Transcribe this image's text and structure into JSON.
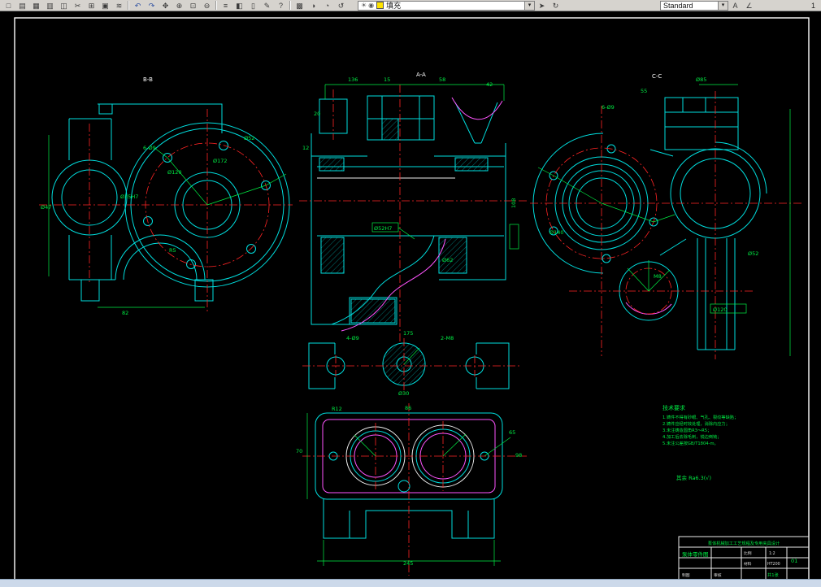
{
  "window": {
    "page_indicator": "1"
  },
  "toolbar": {
    "dropdown_glyph": "▾",
    "groups": [
      [
        {
          "name": "new",
          "glyph": "□"
        },
        {
          "name": "open",
          "glyph": "▤"
        },
        {
          "name": "save",
          "glyph": "▦"
        },
        {
          "name": "print",
          "glyph": "▥"
        },
        {
          "name": "plot-preview",
          "glyph": "◫"
        },
        {
          "name": "cut",
          "glyph": "✂"
        },
        {
          "name": "copy",
          "glyph": "⊞"
        },
        {
          "name": "paste",
          "glyph": "▣"
        },
        {
          "name": "match-properties",
          "glyph": "≋"
        }
      ],
      [
        {
          "name": "undo",
          "glyph": "↶",
          "color": "#2b4ea0"
        },
        {
          "name": "redo",
          "glyph": "↷",
          "color": "#2b4ea0"
        },
        {
          "name": "pan",
          "glyph": "✥"
        },
        {
          "name": "zoom-realtime",
          "glyph": "⊕"
        },
        {
          "name": "zoom-window",
          "glyph": "⊡"
        },
        {
          "name": "zoom-previous",
          "glyph": "⊖"
        }
      ],
      [
        {
          "name": "properties",
          "glyph": "≡"
        },
        {
          "name": "design-center",
          "glyph": "◧"
        },
        {
          "name": "tool-palettes",
          "glyph": "▯"
        },
        {
          "name": "markup",
          "glyph": "✎"
        },
        {
          "name": "help",
          "glyph": "?"
        }
      ],
      [
        {
          "name": "layer-properties",
          "glyph": "▩"
        },
        {
          "name": "layer-states",
          "glyph": "◑"
        },
        {
          "name": "layer-walk",
          "glyph": "◔"
        },
        {
          "name": "layer-previous",
          "glyph": "↺"
        }
      ],
      [
        {
          "name": "make-object-layer-current",
          "glyph": "➤"
        },
        {
          "name": "layer-update",
          "glyph": "↻"
        }
      ],
      [
        {
          "name": "text-style",
          "glyph": "A"
        },
        {
          "name": "dim-style",
          "glyph": "∠"
        }
      ]
    ],
    "layer_combo": {
      "value": "填充",
      "status_icons": [
        {
          "name": "layer-on",
          "glyph": "☀"
        },
        {
          "name": "layer-bulb",
          "glyph": "◉"
        }
      ]
    },
    "style_combo": {
      "value": "Standard"
    }
  },
  "views": {
    "left_label": "B-B",
    "middle_label": "A-A",
    "right_label": "C-C"
  },
  "dims": {
    "d1": "6-Ø9",
    "d2": "Ø120",
    "d3": "Ø35H7",
    "d4": "Ø172",
    "d5": "Ø52",
    "d6": "Ø47",
    "d7": "R5",
    "d8": "82",
    "d9": "136",
    "d10": "15",
    "d11": "58",
    "d12": "42",
    "d13": "20",
    "d14": "12",
    "d15": "108",
    "d16": "175",
    "d17": "Ø52H7",
    "d18": "Ø62",
    "d19": "4-Ø9",
    "d20": "2-M8",
    "d21": "Ø30",
    "d22": "86",
    "d23": "R12",
    "d24": "65",
    "d25": "98",
    "d26": "245",
    "d27": "70",
    "d28": "Ø85",
    "d29": "55",
    "d30": "Ø140",
    "d31": "Ø120",
    "d32": "Ø52",
    "d33": "6-Ø9",
    "d34": "M8"
  },
  "notes": {
    "heading": "技术要求",
    "lines": [
      "1.铸件不得有砂眼、气孔、裂纹等缺陷；",
      "2.铸件应经时效处理，消除内应力；",
      "3.未注铸造圆角R3～R5；",
      "4.加工后去除毛刺，锐边倒钝；",
      "5.未注公差按GB/T1804-m。"
    ],
    "other": "其余 Ra6.3(√)"
  },
  "title_block": {
    "title_line": "泵体机械加工工艺规程及专用夹具设计",
    "part_name": "泵体零件图",
    "scale_label": "比例",
    "scale": "1:2",
    "material_label": "材料",
    "material": "HT200",
    "drafter_label": "制图",
    "checker_label": "审核",
    "sheet": "共1张",
    "number": "01"
  }
}
